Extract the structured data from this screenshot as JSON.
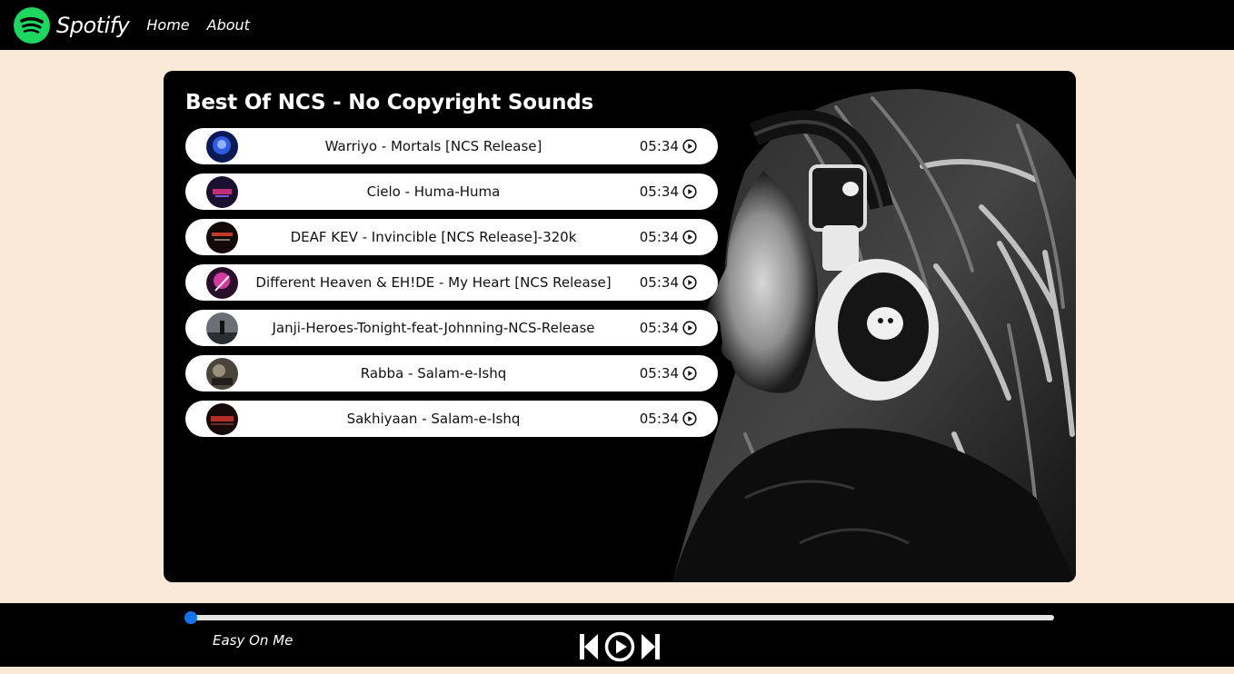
{
  "navbar": {
    "brand": "Spotify",
    "links": [
      "Home",
      "About"
    ]
  },
  "playlist": {
    "title": "Best Of NCS - No Copyright Sounds",
    "songs": [
      {
        "name": "Warriyo - Mortals [NCS Release]",
        "duration": "05:34"
      },
      {
        "name": "Cielo - Huma-Huma",
        "duration": "05:34"
      },
      {
        "name": "DEAF KEV - Invincible [NCS Release]-320k",
        "duration": "05:34"
      },
      {
        "name": "Different Heaven & EH!DE - My Heart [NCS Release]",
        "duration": "05:34"
      },
      {
        "name": "Janji-Heroes-Tonight-feat-Johnning-NCS-Release",
        "duration": "05:34"
      },
      {
        "name": "Rabba - Salam-e-Ishq",
        "duration": "05:34"
      },
      {
        "name": "Sakhiyaan - Salam-e-Ishq",
        "duration": "05:34"
      }
    ]
  },
  "player": {
    "now_playing": "Easy On Me",
    "progress_percent": 0
  },
  "colors": {
    "page_bg": "#fbe9d7",
    "brand_green": "#1ed760",
    "progress_blue": "#1273eb"
  },
  "icons": [
    "spotify-logo-icon",
    "play-circle-icon",
    "previous-icon",
    "play-icon",
    "next-icon"
  ]
}
